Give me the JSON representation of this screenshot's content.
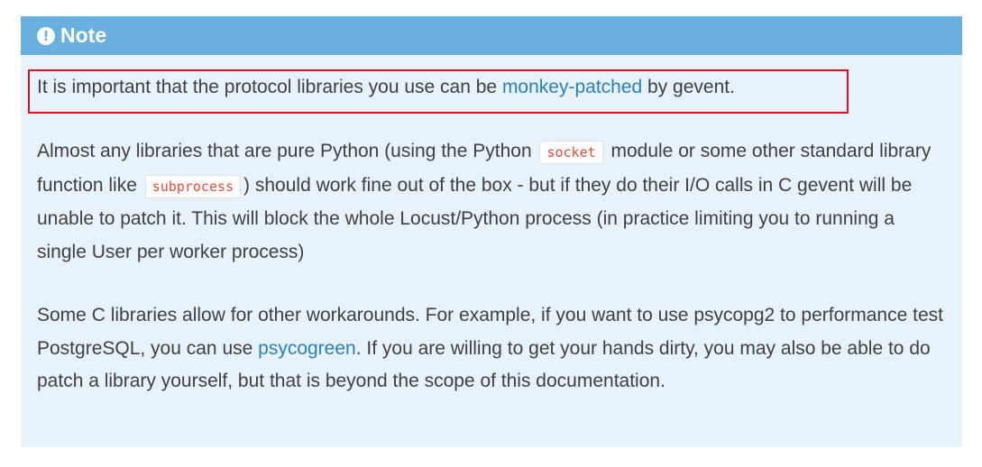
{
  "note": {
    "title": "Note",
    "icon": "exclamation-circle-icon",
    "title_bg_color": "#6ab0de",
    "body_bg_color": "#e7f2fa",
    "highlight_color": "#e5101e"
  },
  "paragraph1": {
    "text_before": "It is important that the protocol libraries you use can be ",
    "link": "monkey-patched",
    "text_after": " by gevent."
  },
  "paragraph2": {
    "text1": "Almost any libraries that are pure Python (using the Python ",
    "code1": "socket",
    "text2": " module or some other standard library function like ",
    "code2": "subprocess",
    "text3": ") should work fine out of the box - but if they do their I/O calls in C gevent will be unable to patch it. This will block the whole Locust/Python process (in practice limiting you to running a single User per worker process)"
  },
  "paragraph3": {
    "text1": "Some C libraries allow for other workarounds. For example, if you want to use psycopg2 to performance test PostgreSQL, you can use ",
    "link": "psycogreen",
    "text2": ". If you are willing to get your hands dirty, you may also be able to do patch a library yourself, but that is beyond the scope of this documentation."
  }
}
